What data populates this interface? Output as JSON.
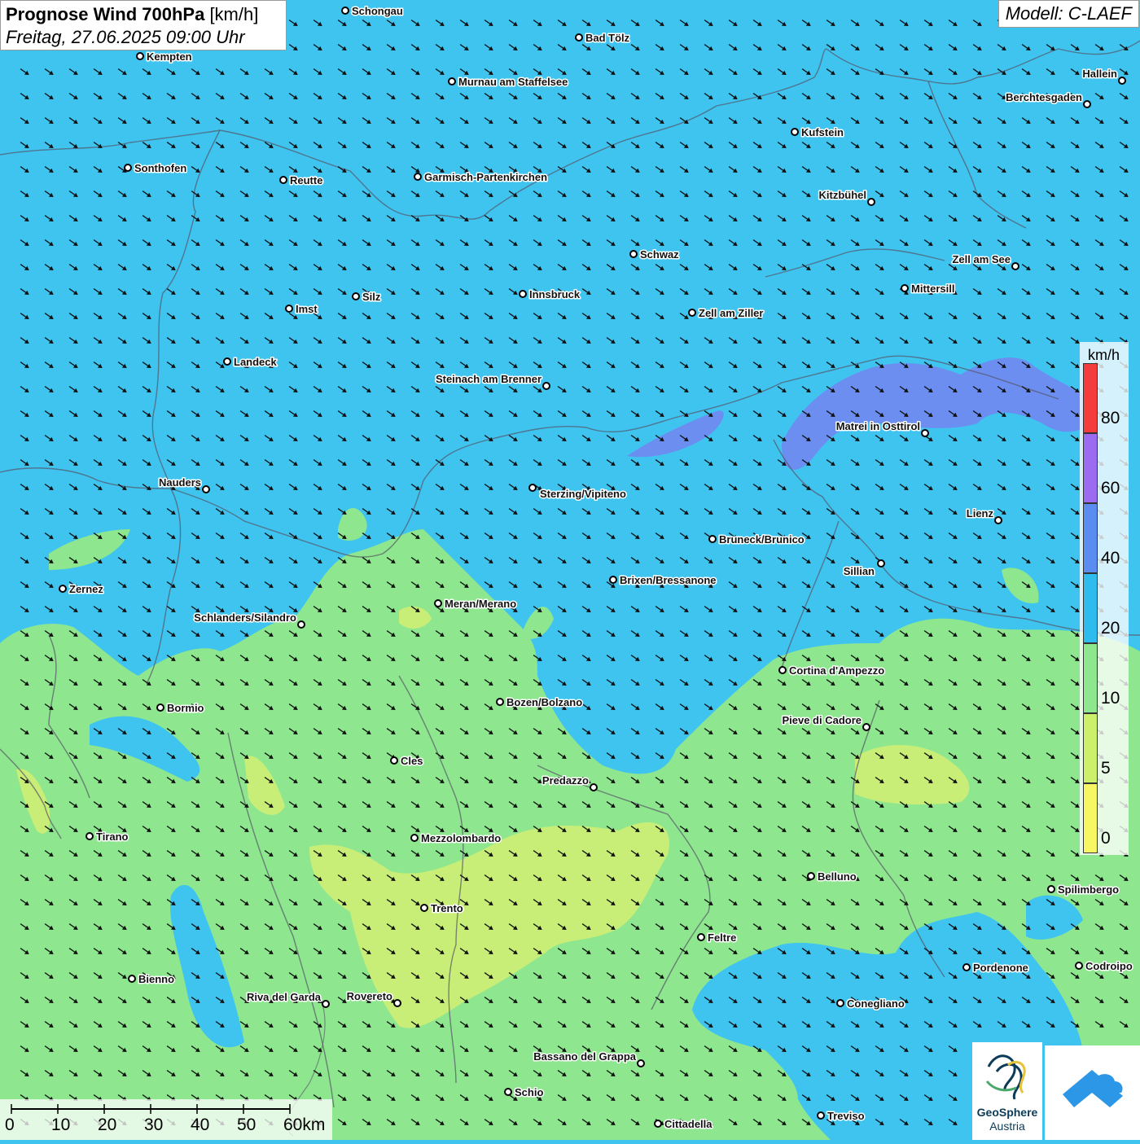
{
  "header": {
    "title_bold": "Prognose Wind 700hPa",
    "title_unit": "[km/h]",
    "datetime": "Freitag, 27.06.2025 09:00 Uhr"
  },
  "model_label": "Modell: C-LAEF",
  "legend": {
    "unit": "km/h",
    "entries": [
      {
        "label": "80",
        "color": "#f53c3c"
      },
      {
        "label": "60",
        "color": "#9b6cf0"
      },
      {
        "label": "40",
        "color": "#5b8cf0"
      },
      {
        "label": "20",
        "color": "#2ebbee"
      },
      {
        "label": "10",
        "color": "#8ee68e"
      },
      {
        "label": "5",
        "color": "#cdf06a"
      },
      {
        "label": "0",
        "color": "#f7f763"
      }
    ]
  },
  "colors": {
    "wind_20_40": "#3fc4f0",
    "wind_10_20": "#8ee68e",
    "wind_5_10": "#c8ee78",
    "wind_40_60": "#6b8ef0",
    "arrow": "#111111"
  },
  "cities": [
    {
      "name": "Schongau"
    },
    {
      "name": "Bad Tölz"
    },
    {
      "name": "Kempten"
    },
    {
      "name": "Hallein"
    },
    {
      "name": "Murnau am Staffelsee"
    },
    {
      "name": "Berchtesgaden"
    },
    {
      "name": "Kufstein"
    },
    {
      "name": "Sonthofen"
    },
    {
      "name": "Reutte"
    },
    {
      "name": "Garmisch-Partenkirchen"
    },
    {
      "name": "Kitzbühel"
    },
    {
      "name": "Schwaz"
    },
    {
      "name": "Zell am See"
    },
    {
      "name": "Mittersill"
    },
    {
      "name": "Innsbruck"
    },
    {
      "name": "Silz"
    },
    {
      "name": "Imst"
    },
    {
      "name": "Zell am Ziller"
    },
    {
      "name": "Landeck"
    },
    {
      "name": "Steinach am Brenner"
    },
    {
      "name": "Matrei in Osttirol"
    },
    {
      "name": "Nauders"
    },
    {
      "name": "Sterzing/Vipiteno"
    },
    {
      "name": "Lienz"
    },
    {
      "name": "Bruneck/Brunico"
    },
    {
      "name": "Sillian"
    },
    {
      "name": "Brixen/Bressanone"
    },
    {
      "name": "Zernez"
    },
    {
      "name": "Meran/Merano"
    },
    {
      "name": "Schlanders/Silandro"
    },
    {
      "name": "Cortina d'Ampezzo"
    },
    {
      "name": "Bozen/Bolzano"
    },
    {
      "name": "Bormio"
    },
    {
      "name": "Pieve di Cadore"
    },
    {
      "name": "Cles"
    },
    {
      "name": "Predazzo"
    },
    {
      "name": "Tirano"
    },
    {
      "name": "Mezzolombardo"
    },
    {
      "name": "Belluno"
    },
    {
      "name": "Spilimbergo"
    },
    {
      "name": "Trento"
    },
    {
      "name": "Feltre"
    },
    {
      "name": "Bienno"
    },
    {
      "name": "Pordenone"
    },
    {
      "name": "Codroipo"
    },
    {
      "name": "Riva del Garda"
    },
    {
      "name": "Rovereto"
    },
    {
      "name": "Conegliano"
    },
    {
      "name": "Bassano del Grappa"
    },
    {
      "name": "Schio"
    },
    {
      "name": "Treviso"
    },
    {
      "name": "Cittadella"
    }
  ],
  "scalebar": {
    "ticks": [
      "0",
      "10",
      "20",
      "30",
      "40",
      "50",
      "60km"
    ]
  },
  "logos": {
    "geosphere_line1": "GeoSphere",
    "geosphere_line2": "Austria",
    "app_icon": "cloud-arrow-app-icon"
  }
}
